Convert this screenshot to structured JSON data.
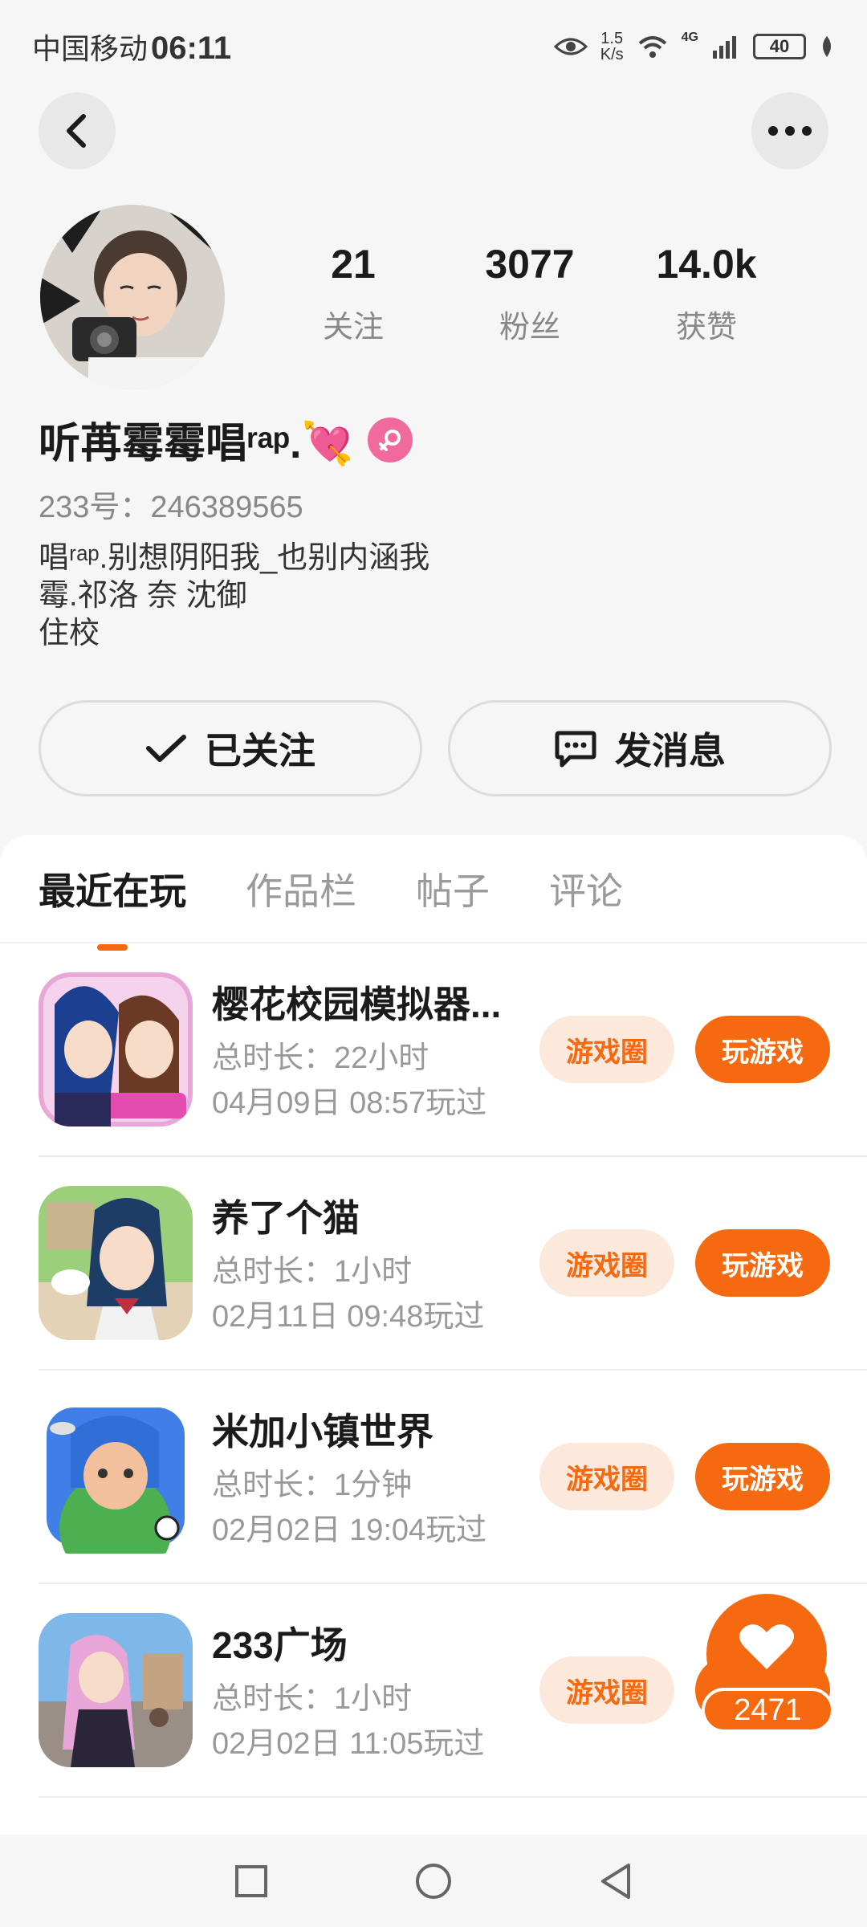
{
  "status_bar": {
    "carrier": "中国移动",
    "time": "06:11",
    "speed_value": "1.5",
    "speed_unit": "K/s",
    "network": "4G",
    "battery": "40"
  },
  "profile": {
    "stats": [
      {
        "value": "21",
        "label": "关注"
      },
      {
        "value": "3077",
        "label": "粉丝"
      },
      {
        "value": "14.0k",
        "label": "获赞"
      }
    ],
    "name": "听苒霉霉唱ʳᵃᵖ.💘",
    "id_text": "233号：246389565",
    "bio": [
      "唱ʳᵃᵖ.别想阴阳我_也别内涵我",
      "霉.祁洛 奈 沈御",
      "住校"
    ]
  },
  "actions": {
    "follow_label": "已关注",
    "message_label": "发消息"
  },
  "tabs": [
    {
      "label": "最近在玩",
      "active": true
    },
    {
      "label": "作品栏",
      "active": false
    },
    {
      "label": "帖子",
      "active": false
    },
    {
      "label": "评论",
      "active": false
    }
  ],
  "games": [
    {
      "title": "樱花校园模拟器...",
      "duration": "总时长：22小时",
      "last_played": "04月09日 08:57玩过",
      "circle_label": "游戏圈",
      "play_label": "玩游戏"
    },
    {
      "title": "养了个猫",
      "duration": "总时长：1小时",
      "last_played": "02月11日 09:48玩过",
      "circle_label": "游戏圈",
      "play_label": "玩游戏"
    },
    {
      "title": "米加小镇世界",
      "duration": "总时长：1分钟",
      "last_played": "02月02日 19:04玩过",
      "circle_label": "游戏圈",
      "play_label": "玩游戏"
    },
    {
      "title": "233广场",
      "duration": "总时长：1小时",
      "last_played": "02月02日 11:05玩过",
      "circle_label": "游戏圈",
      "play_label": ""
    }
  ],
  "like_fab": {
    "count": "2471"
  },
  "colors": {
    "accent": "#f56a10",
    "accent_light": "#fde8dc",
    "gender": "#f06a9c"
  }
}
